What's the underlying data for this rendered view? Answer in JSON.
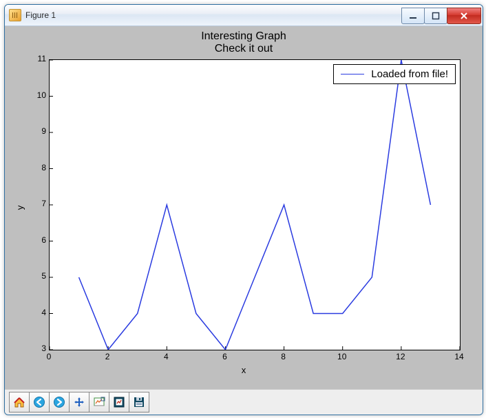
{
  "window": {
    "title": "Figure 1"
  },
  "toolbar": {
    "home": "Home",
    "back": "Back",
    "forward": "Forward",
    "pan": "Pan",
    "zoom": "Zoom",
    "subplots": "Configure subplots",
    "save": "Save"
  },
  "chart_data": {
    "type": "line",
    "title": "Interesting Graph",
    "subtitle": "Check it out",
    "xlabel": "x",
    "ylabel": "y",
    "xlim": [
      0,
      14
    ],
    "ylim": [
      3,
      11
    ],
    "xticks": [
      0,
      2,
      4,
      6,
      8,
      10,
      12,
      14
    ],
    "yticks": [
      3,
      4,
      5,
      6,
      7,
      8,
      9,
      10,
      11
    ],
    "series": [
      {
        "name": "Loaded from file!",
        "color": "#2a3be0",
        "x": [
          1,
          2,
          3,
          4,
          5,
          6,
          7,
          8,
          9,
          10,
          11,
          12,
          13
        ],
        "y": [
          5,
          3,
          4,
          7,
          4,
          3,
          5,
          7,
          4,
          4,
          5,
          11,
          7
        ]
      }
    ],
    "legend": {
      "position": "upper right"
    }
  }
}
